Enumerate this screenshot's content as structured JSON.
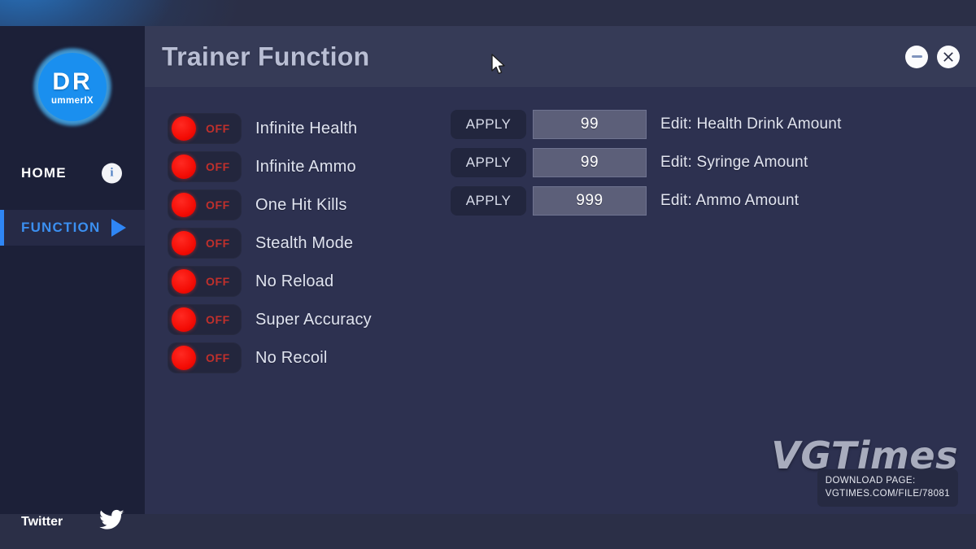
{
  "window": {
    "title": "Trainer Function",
    "minimize_label": "minimize",
    "close_label": "close"
  },
  "sidebar": {
    "logo": {
      "primary": "DR",
      "secondary": "ummerIX"
    },
    "nav": [
      {
        "label": "HOME",
        "icon": "info-icon",
        "active": false
      },
      {
        "label": "FUNCTION",
        "icon": "play-icon",
        "active": true
      }
    ],
    "social": {
      "label": "Twitter",
      "icon": "twitter-icon"
    }
  },
  "toggles": [
    {
      "label": "Infinite Health",
      "state": "OFF"
    },
    {
      "label": "Infinite Ammo",
      "state": "OFF"
    },
    {
      "label": "One Hit Kills",
      "state": "OFF"
    },
    {
      "label": "Stealth Mode",
      "state": "OFF"
    },
    {
      "label": "No Reload",
      "state": "OFF"
    },
    {
      "label": "Super Accuracy",
      "state": "OFF"
    },
    {
      "label": "No Recoil",
      "state": "OFF"
    }
  ],
  "edits": [
    {
      "button": "APPLY",
      "value": "99",
      "label": "Edit: Health Drink Amount"
    },
    {
      "button": "APPLY",
      "value": "99",
      "label": "Edit: Syringe Amount"
    },
    {
      "button": "APPLY",
      "value": "999",
      "label": "Edit: Ammo Amount"
    }
  ],
  "watermark": {
    "brand": "VGTimes",
    "download_line1": "DOWNLOAD PAGE:",
    "download_line2": "VGTIMES.COM/FILE/78081"
  },
  "colors": {
    "accent_blue": "#2f86f5",
    "logo_blue": "#1a8fef",
    "toggle_red": "#f40c05",
    "header_bg": "#363b57",
    "content_bg": "#2d3150",
    "sidebar_bg": "#1c2038"
  }
}
